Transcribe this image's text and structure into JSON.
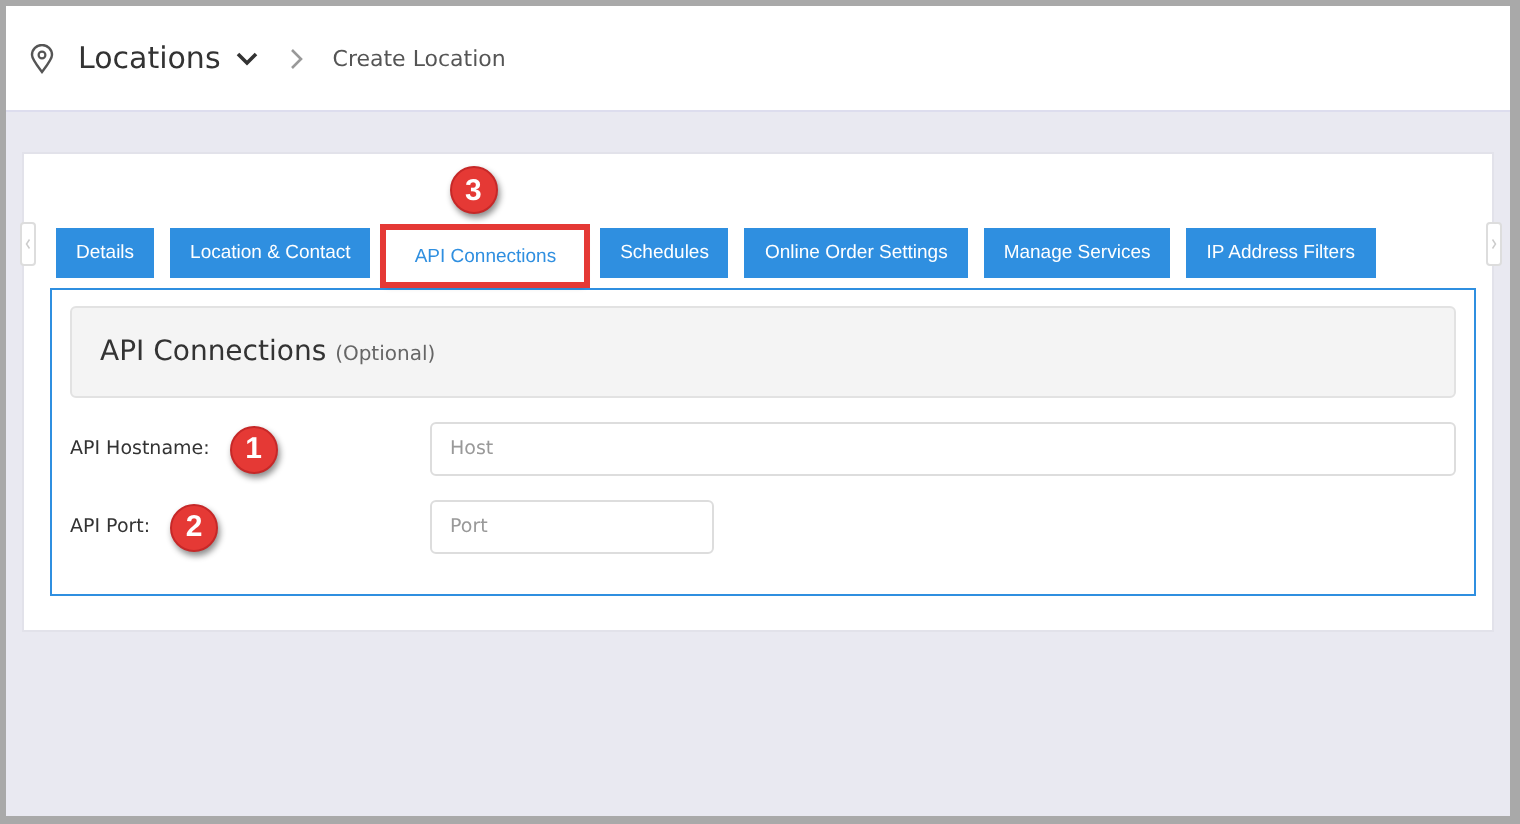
{
  "breadcrumb": {
    "section": "Locations",
    "page": "Create Location"
  },
  "tabs": [
    {
      "label": "Details",
      "selected": false
    },
    {
      "label": "Location & Contact",
      "selected": false
    },
    {
      "label": "API Connections",
      "selected": true,
      "callout": "3"
    },
    {
      "label": "Schedules",
      "selected": false
    },
    {
      "label": "Online Order Settings",
      "selected": false
    },
    {
      "label": "Manage Services",
      "selected": false
    },
    {
      "label": "IP Address Filters",
      "selected": false
    }
  ],
  "section": {
    "title": "API Connections",
    "note": "(Optional)"
  },
  "fields": [
    {
      "label": "API Hostname:",
      "placeholder": "Host",
      "callout": "1"
    },
    {
      "label": "API Port:",
      "placeholder": "Port",
      "callout": "2"
    }
  ]
}
